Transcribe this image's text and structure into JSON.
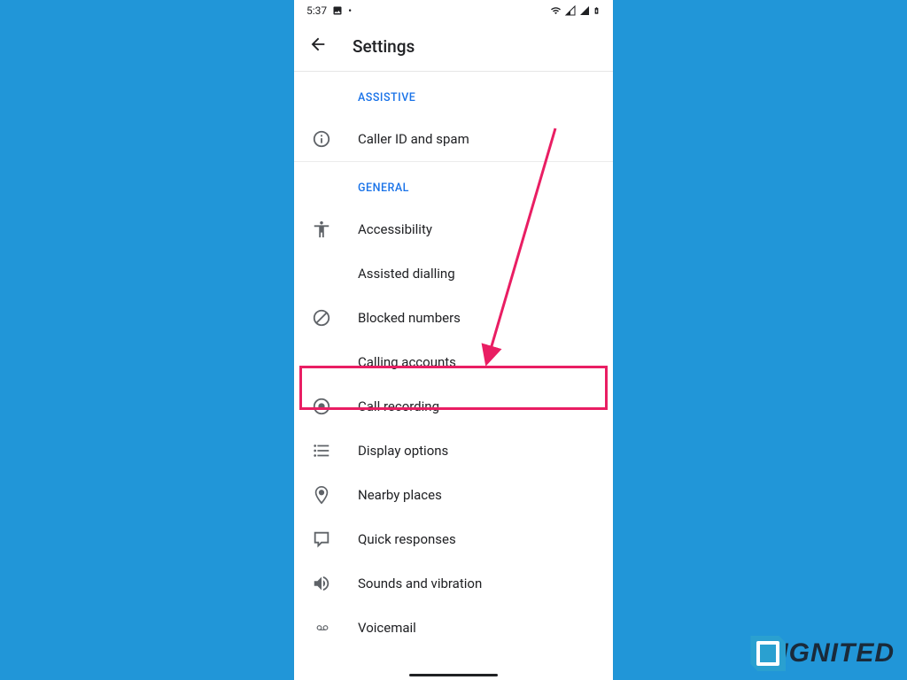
{
  "status": {
    "time": "5:37",
    "dot": "•"
  },
  "header": {
    "title": "Settings"
  },
  "sections": {
    "assistive": {
      "label": "ASSISTIVE",
      "items": [
        {
          "label": "Caller ID and spam"
        }
      ]
    },
    "general": {
      "label": "GENERAL",
      "items": [
        {
          "label": "Accessibility"
        },
        {
          "label": "Assisted dialling"
        },
        {
          "label": "Blocked numbers"
        },
        {
          "label": "Calling accounts"
        },
        {
          "label": "Call recording"
        },
        {
          "label": "Display options"
        },
        {
          "label": "Nearby places"
        },
        {
          "label": "Quick responses"
        },
        {
          "label": "Sounds and vibration"
        },
        {
          "label": "Voicemail"
        }
      ]
    }
  },
  "watermark": "IGNITED"
}
